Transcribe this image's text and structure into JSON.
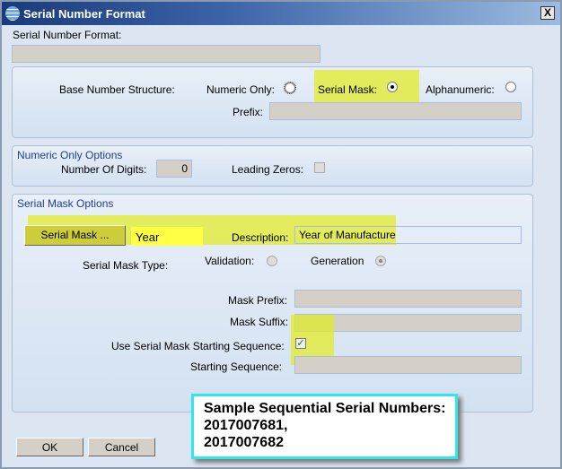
{
  "window": {
    "title": "Serial Number Format",
    "close": "X"
  },
  "serial_number_format": {
    "label": "Serial Number Format:",
    "value": ""
  },
  "base": {
    "label": "Base Number Structure:",
    "numeric_only": "Numeric Only:",
    "serial_mask": "Serial Mask:",
    "alphanumeric": "Alphanumeric:",
    "selected": "Serial Mask",
    "prefix_label": "Prefix:",
    "prefix_value": ""
  },
  "numeric_options": {
    "title": "Numeric Only Options",
    "digits_label": "Number Of Digits:",
    "digits_value": "0",
    "leading_zeros_label": "Leading Zeros:",
    "leading_zeros": false
  },
  "mask_options": {
    "title": "Serial Mask Options",
    "mask_button": "Serial Mask ...",
    "mask_value": "Year",
    "description_label": "Description:",
    "description_value": "Year of Manufacture",
    "type_label": "Serial Mask Type:",
    "validation": "Validation:",
    "generation": "Generation",
    "selected_type": "Generation",
    "mask_prefix_label": "Mask Prefix:",
    "mask_suffix_label": "Mask Suffix:",
    "use_start_label": "Use Serial Mask Starting Sequence:",
    "use_start": true,
    "starting_sequence_label": "Starting Sequence:",
    "starting_sequence_value": ""
  },
  "buttons": {
    "ok": "OK",
    "cancel": "Cancel"
  },
  "callout": {
    "line1": "Sample Sequential Serial Numbers:",
    "line2": "2017007681,",
    "line3": "2017007682"
  },
  "colors": {
    "highlight": "#e1eb28",
    "callout_border": "#2ee8ee"
  }
}
